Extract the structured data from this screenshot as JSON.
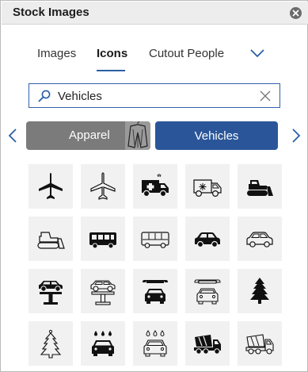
{
  "window": {
    "title": "Stock Images"
  },
  "tabs": [
    {
      "label": "Images"
    },
    {
      "label": "Icons"
    },
    {
      "label": "Cutout People"
    }
  ],
  "search": {
    "value": "Vehicles"
  },
  "categories": [
    {
      "label": "Apparel"
    },
    {
      "label": "Vehicles"
    }
  ],
  "colors": {
    "accent": "#2a5699",
    "chip_inactive": "#7b7b7b",
    "tile_bg": "#f1f1f1"
  },
  "icons": [
    "airplane-filled-icon",
    "airplane-outline-icon",
    "ambulance-filled-icon",
    "ambulance-outline-icon",
    "bulldozer-filled-icon",
    "bulldozer-outline-icon",
    "bus-filled-icon",
    "bus-outline-icon",
    "car-filled-icon",
    "car-outline-icon",
    "car-lift-filled-icon",
    "car-lift-outline-icon",
    "car-repair-filled-icon",
    "car-repair-outline-icon",
    "air-freshener-filled-icon",
    "air-freshener-outline-icon",
    "car-wash-filled-icon",
    "car-wash-outline-icon",
    "cement-truck-filled-icon",
    "cement-truck-outline-icon"
  ]
}
